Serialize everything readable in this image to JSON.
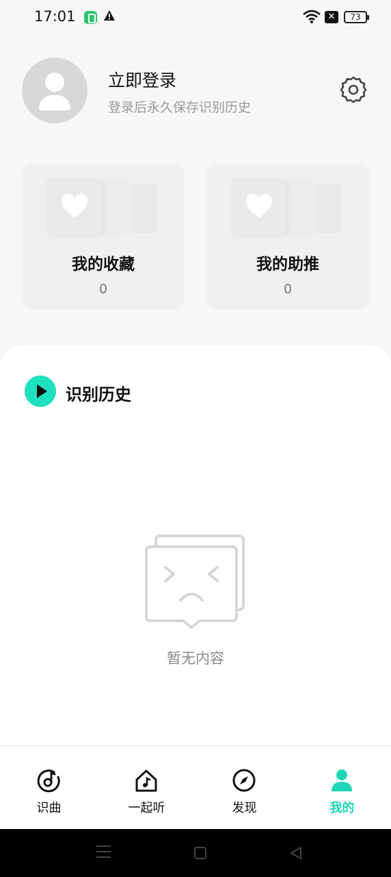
{
  "status_bar": {
    "time": "17:01",
    "battery": "73"
  },
  "profile": {
    "title": "立即登录",
    "subtitle": "登录后永久保存识别历史"
  },
  "cards": [
    {
      "title": "我的收藏",
      "count": "0"
    },
    {
      "title": "我的助推",
      "count": "0"
    }
  ],
  "history": {
    "title": "识别历史",
    "empty_text": "暂无内容"
  },
  "tabs": [
    {
      "label": "识曲",
      "icon": "music-note-circle-icon"
    },
    {
      "label": "一起听",
      "icon": "music-house-icon"
    },
    {
      "label": "发现",
      "icon": "compass-icon"
    },
    {
      "label": "我的",
      "icon": "person-icon",
      "active": true
    }
  ],
  "colors": {
    "accent": "#1fd6b8",
    "play_bg": "#1fe0bf",
    "page_bg": "#f7f7f7"
  }
}
